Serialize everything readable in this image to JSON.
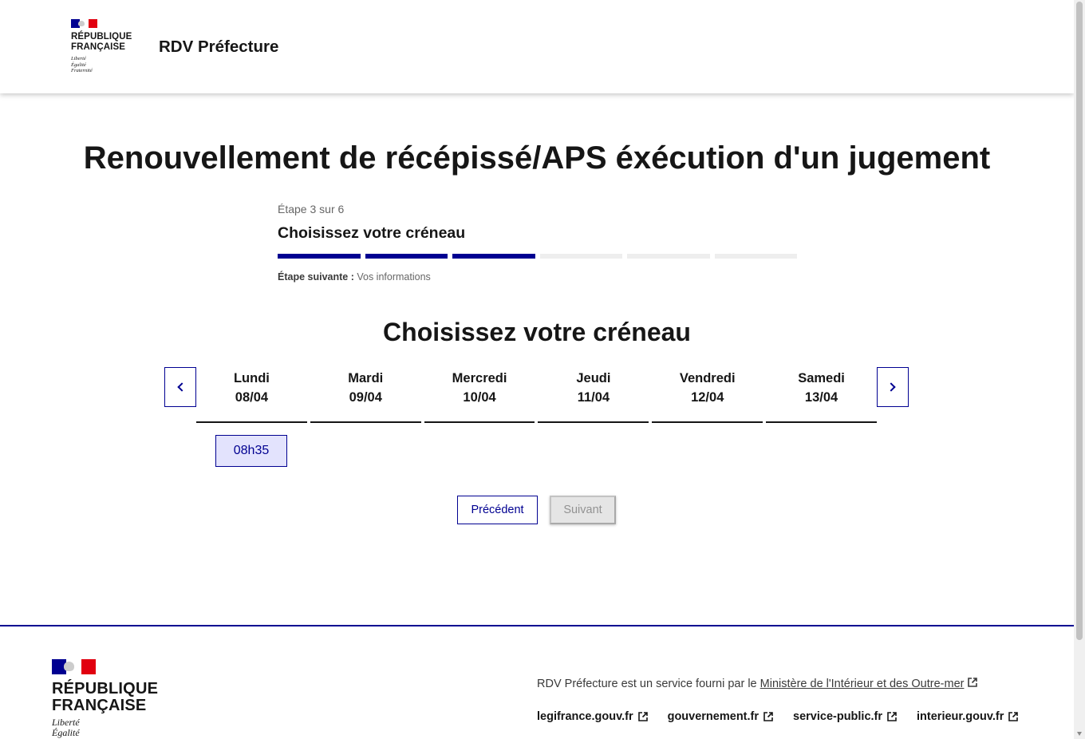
{
  "header": {
    "logo_line1": "RÉPUBLIQUE",
    "logo_line2": "FRANÇAISE",
    "devise": [
      "Liberté",
      "Égalité",
      "Fraternité"
    ],
    "service_name": "RDV Préfecture"
  },
  "main": {
    "title": "Renouvellement de récépissé/APS éxécution d'un jugement",
    "stepper": {
      "state": "Étape 3 sur 6",
      "title": "Choisissez votre créneau",
      "current_step": 3,
      "total_steps": 6,
      "next_label": "Étape suivante :",
      "next_value": "Vos informations"
    },
    "slot_section_title": "Choisissez votre créneau",
    "days": [
      {
        "name": "Lundi",
        "date": "08/04"
      },
      {
        "name": "Mardi",
        "date": "09/04"
      },
      {
        "name": "Mercredi",
        "date": "10/04"
      },
      {
        "name": "Jeudi",
        "date": "11/04"
      },
      {
        "name": "Vendredi",
        "date": "12/04"
      },
      {
        "name": "Samedi",
        "date": "13/04"
      }
    ],
    "slots": [
      {
        "day_index": 0,
        "time": "08h35"
      }
    ],
    "buttons": {
      "previous": "Précédent",
      "next": "Suivant"
    }
  },
  "footer": {
    "logo_line1": "RÉPUBLIQUE",
    "logo_line2": "FRANÇAISE",
    "devise": [
      "Liberté",
      "Égalité"
    ],
    "desc_prefix": "RDV Préfecture est un service fourni par le",
    "desc_link": "Ministère de l'Intérieur et des Outre-mer",
    "links": [
      "legifrance.gouv.fr",
      "gouvernement.fr",
      "service-public.fr",
      "interieur.gouv.fr"
    ]
  },
  "colors": {
    "primary": "#000091",
    "flag_red": "#e1000f",
    "slot_bg": "#e3e3fd",
    "disabled_bg": "#e5e5e5"
  }
}
